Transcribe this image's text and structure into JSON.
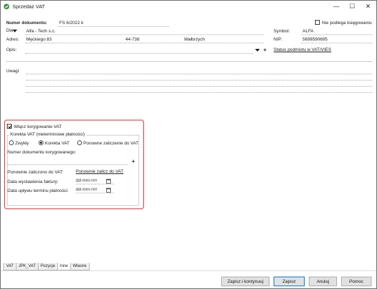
{
  "window": {
    "title": "Sprzedaż VAT",
    "minimize": "—",
    "maximize": "☐",
    "close": "✕"
  },
  "header": {
    "doc_number_label": "Numer dokumentu:",
    "doc_number_value": "FS 6/2022 k",
    "nie_podlega_label": "Nie podlega księgowaniu",
    "nie_podlega_checked": false
  },
  "contractor": {
    "dla_label": "Dla",
    "name": "Alfa - Tech s.c.",
    "symbol_label": "Symbol:",
    "symbol_value": "ALFA",
    "adres_label": "Adres:",
    "street": "Męckiego  83",
    "postcode": "44-738",
    "city": "Wałbrzych",
    "nip_label": "NIP:",
    "nip_value": "5699590695",
    "opis_label": "Opis:",
    "opis_value": "",
    "status_link": "Status podmiotu w VAT/VIES",
    "plus": "+"
  },
  "uwagi": {
    "label": "Uwagi:",
    "value": ""
  },
  "korekta": {
    "enable_label": "Włącz korygowanie VAT",
    "enable_checked": true,
    "group_label": "Korekta VAT (nieterminowe płatności)",
    "options": [
      "Zwykły",
      "Korekta VAT",
      "Ponowne zaliczenie do VAT"
    ],
    "selected_option": 1,
    "doc_corrected_label": "Numer dokumentu korygowanego:",
    "doc_corrected_value": "",
    "plus": "+",
    "ponownie_label": "Ponownie zaliczono do VAT:",
    "ponownie_link": "Ponownie zalicz do VAT",
    "data_wyst_label": "Data wystawienia faktury:",
    "data_wyst_value": "dd-mm-rrrr",
    "data_uplywu_label": "Data upływu terminu płatności:",
    "data_uplywu_value": "dd-mm-rrrr"
  },
  "tabs": [
    "VAT",
    "JPK_VAT",
    "Pozycje",
    "Inne",
    "Własne"
  ],
  "active_tab": 3,
  "buttons": {
    "zapisz_kontynuuj": "Zapisz i kontynuuj",
    "zapisz": "Zapisz",
    "anuluj": "Anuluj",
    "pomoc": "Pomoc"
  },
  "colors": {
    "highlight": "#e0302c",
    "primary_border": "#0078d7"
  }
}
